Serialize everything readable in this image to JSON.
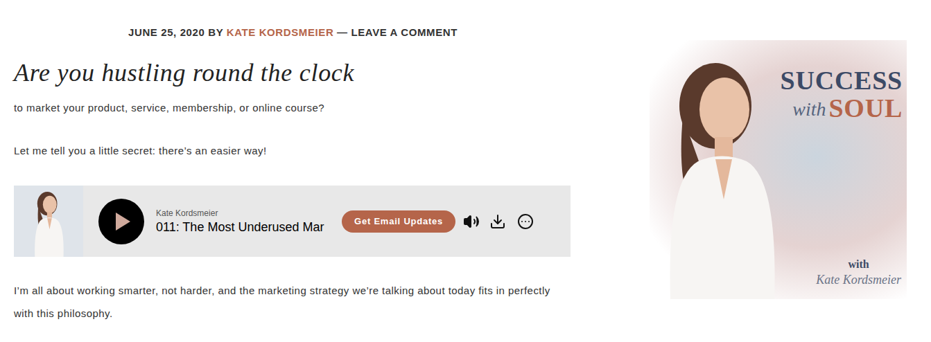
{
  "post_meta": {
    "date": "JUNE 25, 2020",
    "by": "BY",
    "author": "KATE KORDSMEIER",
    "separator": "—",
    "comment_link": "LEAVE A COMMENT"
  },
  "heading": "Are you hustling round the clock",
  "intro_paragraphs": [
    "to market your product, service, membership, or online course?",
    "Let me tell you a little secret: there’s an easier way!"
  ],
  "player": {
    "artist": "Kate Kordsmeier",
    "episode": "011: The Most Underused Mar",
    "button": "Get Email Updates",
    "playing": false
  },
  "body_paragraphs": [
    "I’m all about working smarter, not harder, and the marketing strategy we’re talking about today fits in perfectly with this philosophy."
  ],
  "cover": {
    "title_top": "SUCCESS",
    "title_with": "with",
    "title_bottom": "SOUL",
    "byline_with": "with",
    "byline_name": "Kate Kordsmeier"
  }
}
